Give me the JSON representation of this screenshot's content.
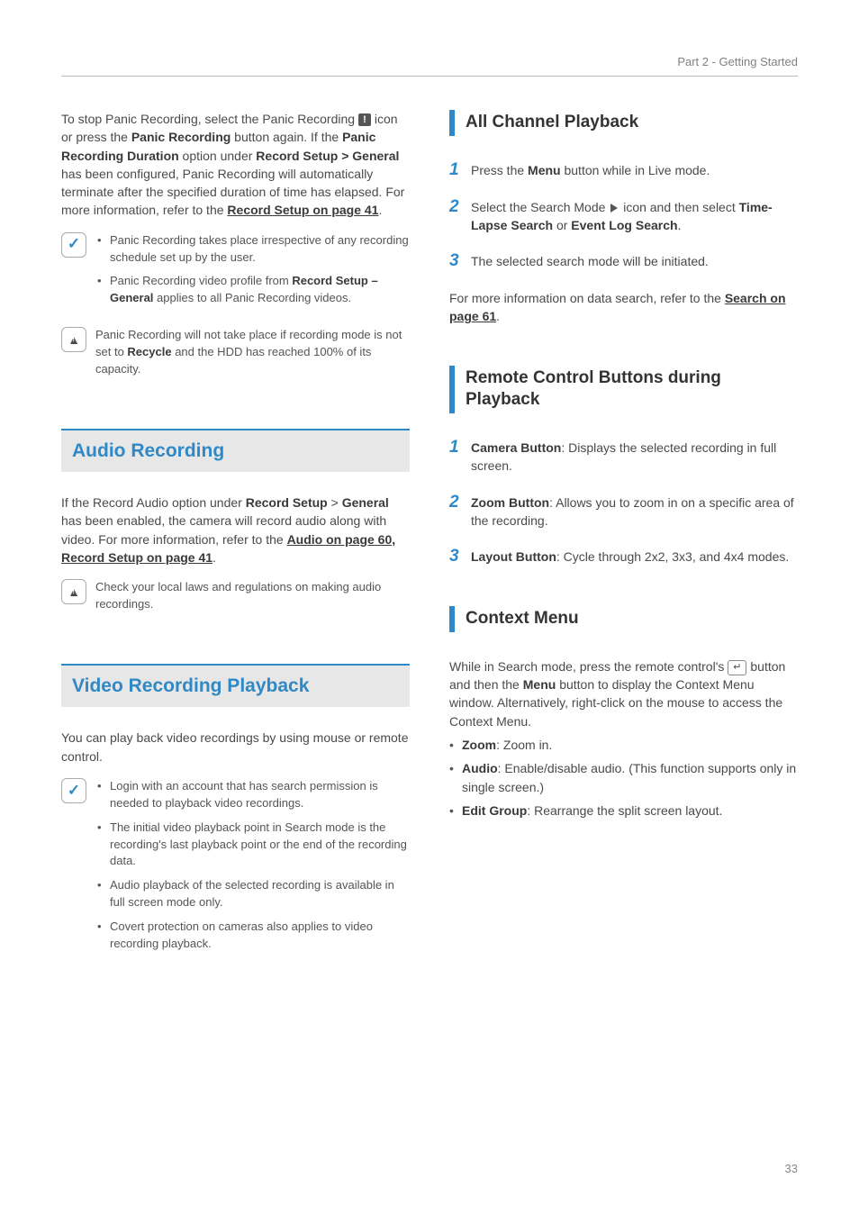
{
  "header": {
    "part_label": "Part 2 - Getting Started"
  },
  "left": {
    "intro_1": "To stop Panic Recording, select the Panic Recording",
    "intro_2a": " icon or press the ",
    "intro_2b": "Panic Recording",
    "intro_2c": " button again. If the ",
    "intro_2d": "Panic Recording Duration",
    "intro_2e": " option under ",
    "intro_2f": "Record Setup > General",
    "intro_2g": " has been configured, Panic Recording will automatically terminate after the specified duration of time has elapsed. For more information, refer to the ",
    "intro_link1": "Record Setup on page 41",
    "intro_2h": ".",
    "tip1_li1": "Panic Recording takes place irrespective of any recording schedule set up by the user.",
    "tip1_li2a": "Panic Recording video profile from ",
    "tip1_li2b": "Record Setup – General",
    "tip1_li2c": " applies to all Panic Recording videos.",
    "warn1a": "Panic Recording will not take place if recording mode is not set to ",
    "warn1b": "Recycle",
    "warn1c": " and the HDD has reached 100% of its capacity.",
    "h_audio": "Audio Recording",
    "audio_p_a": "If the Record Audio option under ",
    "audio_p_b": "Record Setup",
    "audio_p_c": " > ",
    "audio_p_d": "General",
    "audio_p_e": " has been enabled, the camera will record audio along with video. For more information, refer to the ",
    "audio_link": "Audio on page 60,  Record Setup on page 41",
    "audio_p_f": ".",
    "audio_warn": "Check your local laws and regulations on making audio recordings.",
    "h_playback": "Video Recording Playback",
    "playback_p": "You can play back video recordings by using mouse or remote control.",
    "pb_li1": "Login with an account that has search permission is needed to playback video recordings.",
    "pb_li2": "The initial video playback point in Search mode is the recording's last playback point or the end of the recording data.",
    "pb_li3": "Audio playback of the selected recording is available in full screen mode only.",
    "pb_li4": "Covert protection on cameras also applies to video recording playback."
  },
  "right": {
    "h_allch": "All Channel Playback",
    "allch_li1a": "Press the ",
    "allch_li1b": "Menu",
    "allch_li1c": " button while in Live mode.",
    "allch_li2a": "Select the Search Mode ",
    "allch_li2b": " icon and then select ",
    "allch_li2c": "Time-Lapse Search",
    "allch_li2d": " or ",
    "allch_li2e": "Event Log Search",
    "allch_li2f": ".",
    "allch_li3": "The selected search mode will be initiated.",
    "allch_more_a": "For more information on data search, refer to the ",
    "allch_more_link": "Search on page 61",
    "allch_more_b": ".",
    "h_remote": "Remote Control Buttons during Playback",
    "rc_li1a": "Camera Button",
    "rc_li1b": ": Displays the selected recording in full screen.",
    "rc_li2a": "Zoom Button",
    "rc_li2b": ": Allows you to zoom in on a specific area of the recording.",
    "rc_li3a": "Layout Button",
    "rc_li3b": ": Cycle through 2x2, 3x3, and 4x4 modes.",
    "h_ctx": "Context Menu",
    "ctx_p_a": "While in Search mode, press the remote control's ",
    "ctx_p_b": " button and then the ",
    "ctx_p_c": "Menu",
    "ctx_p_d": " button to display the Context Menu window. Alternatively, right-click on the mouse to access the Context Menu.",
    "ctx_li1a": "Zoom",
    "ctx_li1b": ": Zoom in.",
    "ctx_li2a": "Audio",
    "ctx_li2b": ": Enable/disable audio. (This function supports only in single screen.)",
    "ctx_li3a": "Edit Group",
    "ctx_li3b": ": Rearrange the split screen layout."
  },
  "page_number": "33"
}
